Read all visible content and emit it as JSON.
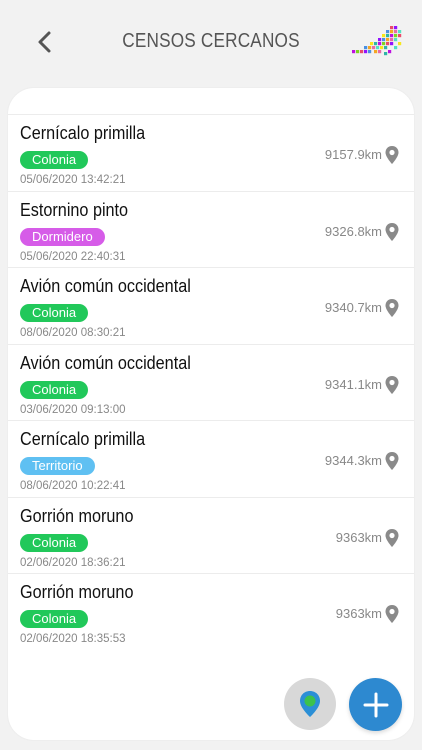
{
  "header": {
    "title": "CENSOS CERCANOS",
    "back_icon": "chevron-left-icon",
    "logo": "canary-islands-mosaic-logo"
  },
  "badge_colors": {
    "Colonia": "#21c85a",
    "Dormidero": "#d65ce8",
    "Territorio": "#5fc0f2"
  },
  "censos": [
    {
      "name": "Cernícalo primilla",
      "badge": "Colonia",
      "date": "05/06/2020 13:42:21",
      "distance": "9157.9km"
    },
    {
      "name": "Estornino pinto",
      "badge": "Dormidero",
      "date": "05/06/2020 22:40:31",
      "distance": "9326.8km"
    },
    {
      "name": "Avión común occidental",
      "badge": "Colonia",
      "date": "08/06/2020 08:30:21",
      "distance": "9340.7km"
    },
    {
      "name": "Avión común occidental",
      "badge": "Colonia",
      "date": "03/06/2020 09:13:00",
      "distance": "9341.1km"
    },
    {
      "name": "Cernícalo primilla",
      "badge": "Territorio",
      "date": "08/06/2020 10:22:41",
      "distance": "9344.3km"
    },
    {
      "name": "Gorrión moruno",
      "badge": "Colonia",
      "date": "02/06/2020 18:36:21",
      "distance": "9363km"
    },
    {
      "name": "Gorrión moruno",
      "badge": "Colonia",
      "date": "02/06/2020 18:35:53",
      "distance": "9363km"
    }
  ],
  "fabs": {
    "map_icon": "map-pin-icon",
    "add_icon": "plus-icon"
  }
}
